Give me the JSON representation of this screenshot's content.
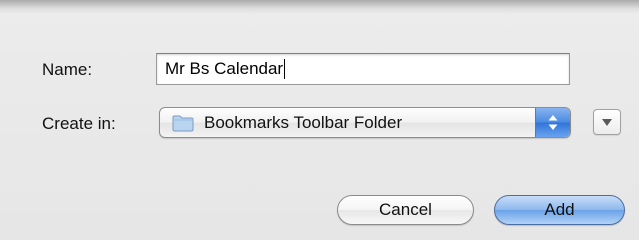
{
  "dialog": {
    "name_label": "Name:",
    "name_value": "Mr Bs Calendar",
    "create_in_label": "Create in:",
    "folder_selected": "Bookmarks Toolbar Folder",
    "folder_icon": "folder-icon",
    "stepper_icon": "up-down-arrows-icon",
    "expand_icon": "chevron-down-icon",
    "cancel_label": "Cancel",
    "add_label": "Add"
  },
  "colors": {
    "default_button": "#8db8ee",
    "stepper": "#4a8ae2",
    "background": "#e9e9e9"
  }
}
